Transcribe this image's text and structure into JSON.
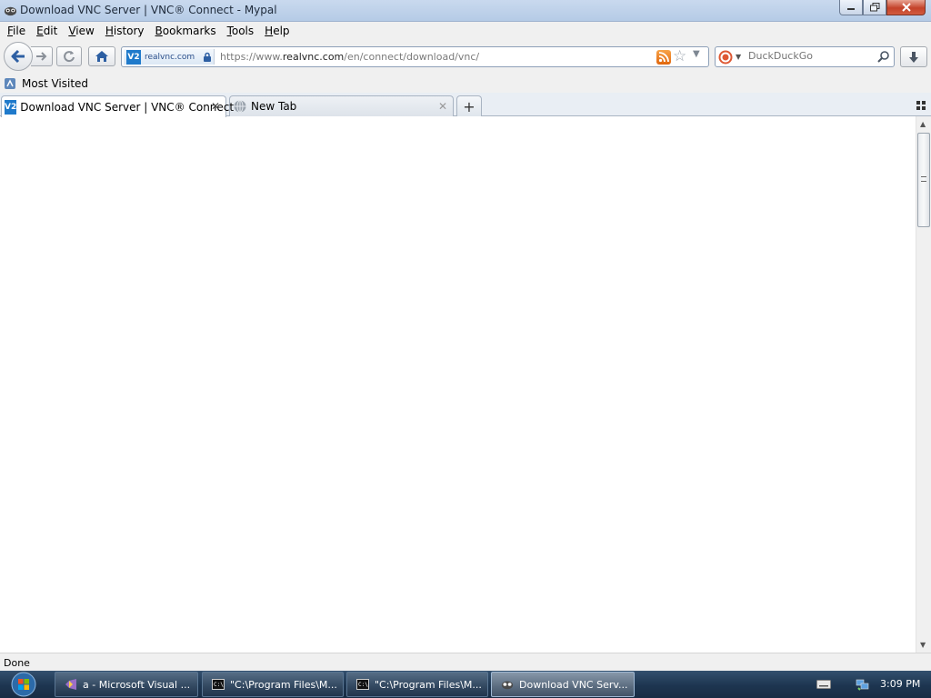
{
  "window": {
    "title": "Download VNC Server | VNC® Connect - Mypal"
  },
  "menubar": {
    "items": [
      {
        "underline": "F",
        "rest": "ile"
      },
      {
        "underline": "E",
        "rest": "dit"
      },
      {
        "underline": "V",
        "rest": "iew"
      },
      {
        "underline": "H",
        "rest": "istory"
      },
      {
        "underline": "B",
        "rest": "ookmarks"
      },
      {
        "underline": "T",
        "rest": "ools"
      },
      {
        "underline": "H",
        "rest": "elp"
      }
    ]
  },
  "navbar": {
    "identity_label": "realvnc.com",
    "site_favicon_text": "V2",
    "url_prefix": "https://www.",
    "url_domain": "realvnc.com",
    "url_path": "/en/connect/download/vnc/",
    "search_placeholder": "DuckDuckGo",
    "icons": {
      "back": "back-arrow-icon",
      "forward": "forward-arrow-icon",
      "reload": "reload-icon",
      "home": "home-icon",
      "lock": "lock-icon",
      "rss": "rss-feed-icon",
      "bookmark": "star-icon",
      "search": "magnifier-icon",
      "downloads": "download-arrow-icon"
    }
  },
  "bookmarks": {
    "items": [
      {
        "label": "Most Visited"
      }
    ]
  },
  "tabs": [
    {
      "label": "Download VNC Server | VNC® Connect",
      "active": true
    },
    {
      "label": "New Tab",
      "active": false
    }
  ],
  "statusbar": {
    "text": "Done"
  },
  "taskbar": {
    "items": [
      {
        "label": "a - Microsoft Visual ...",
        "active": false
      },
      {
        "label": "\"C:\\Program Files\\M...",
        "active": false
      },
      {
        "label": "\"C:\\Program Files\\M...",
        "active": false
      },
      {
        "label": "Download VNC Serv...",
        "active": true
      }
    ],
    "clock": "3:09 PM"
  },
  "colors": {
    "titlebar": "#b5cbe6",
    "toolbar": "#f0f0f0",
    "taskbar": "#1d3550",
    "close_button": "#c4422a"
  }
}
